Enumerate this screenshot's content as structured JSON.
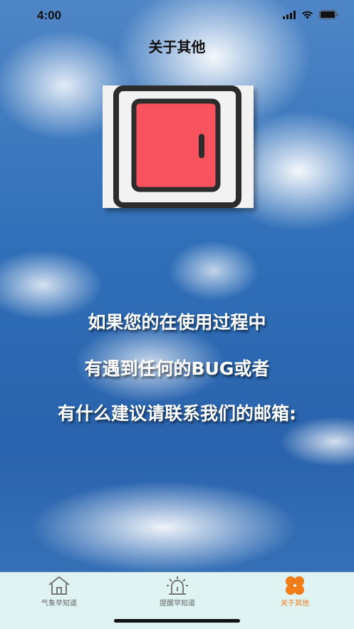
{
  "status_bar": {
    "time": "4:00"
  },
  "nav": {
    "title": "关于其他"
  },
  "hero": {
    "icon": "door-icon",
    "door_color": "#f9525f",
    "frame_color": "#2c2c2c"
  },
  "message": {
    "lines": [
      "如果您的在使用过程中",
      "有遇到任何的BUG或者",
      "有什么建议请联系我们的邮箱:"
    ]
  },
  "tabbar": {
    "accent": "#f07d18",
    "tabs": [
      {
        "label": "气象早知道",
        "icon": "house-icon",
        "active": false
      },
      {
        "label": "提醒早知道",
        "icon": "alarm-light-icon",
        "active": false
      },
      {
        "label": "关于其他",
        "icon": "four-petal-icon",
        "active": true
      }
    ]
  }
}
